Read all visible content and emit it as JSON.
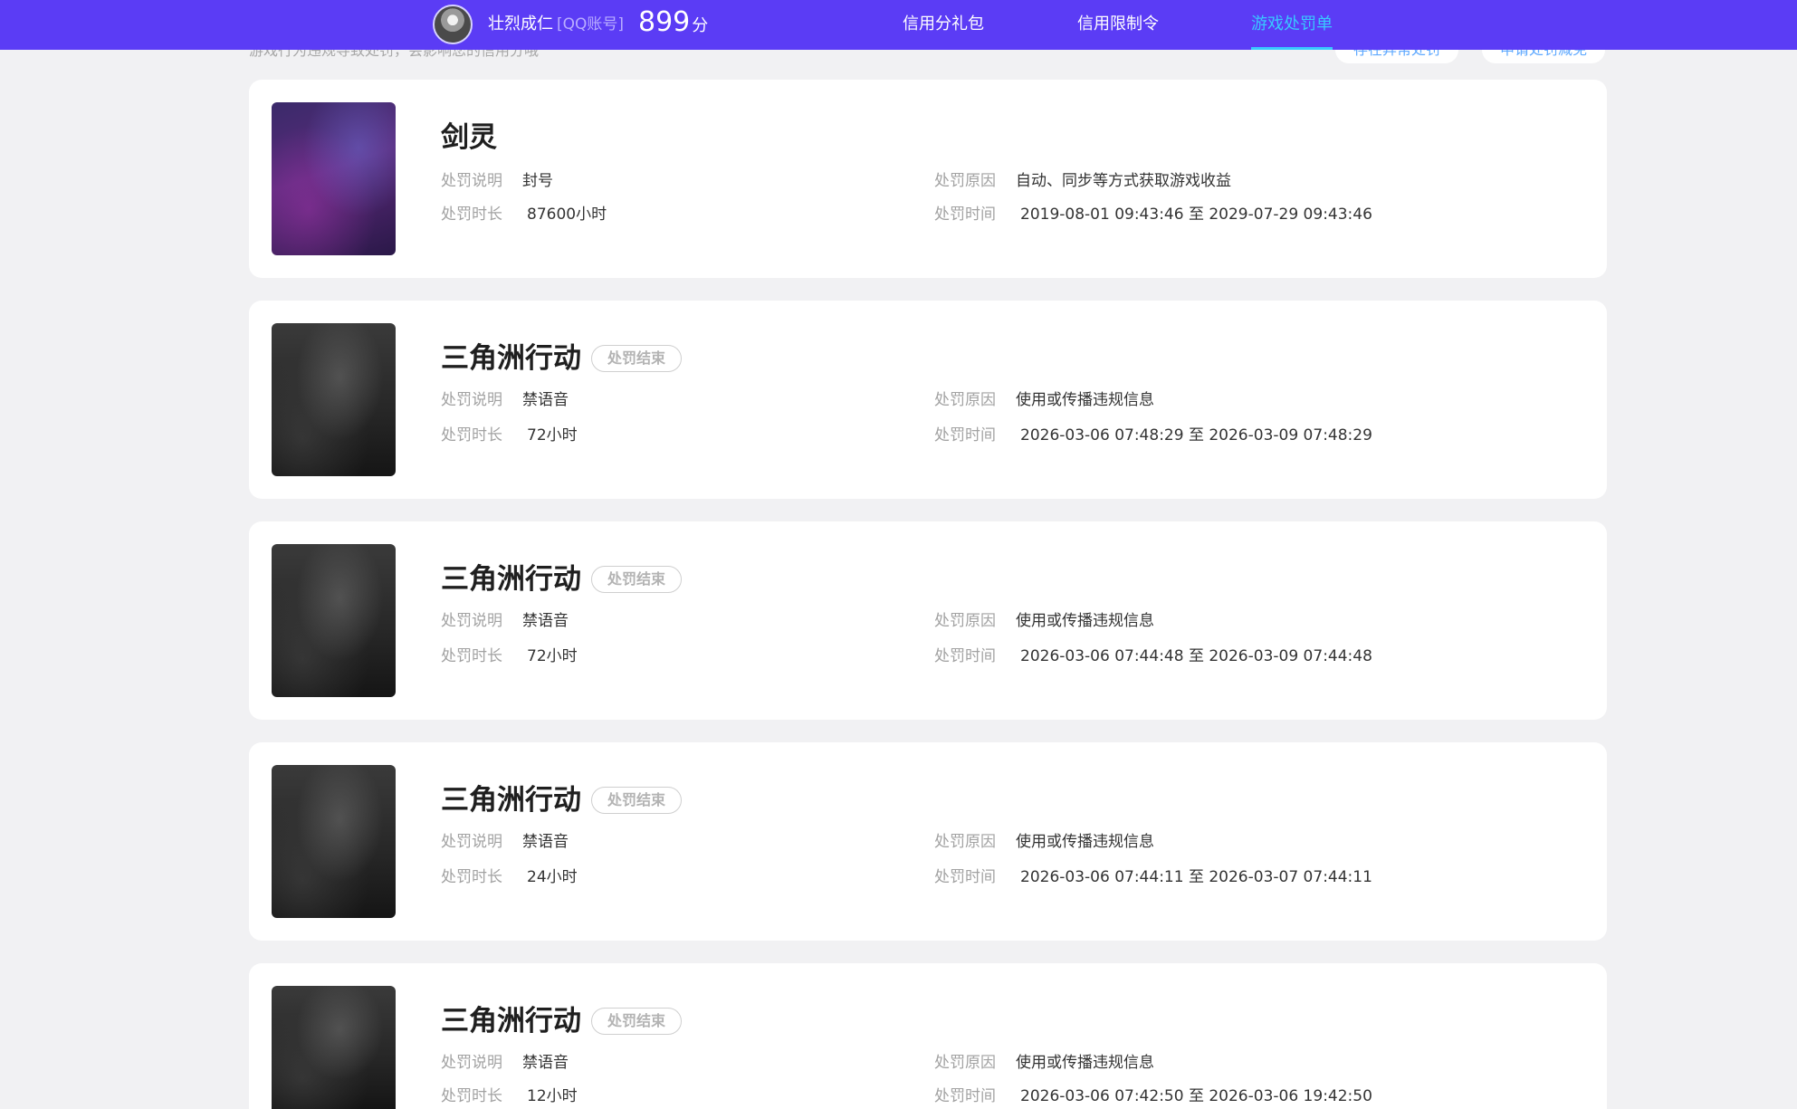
{
  "header": {
    "username": "壮烈成仁",
    "account_type": "[QQ账号]",
    "score": "899",
    "score_unit": "分",
    "tabs": [
      {
        "label": "信用分礼包"
      },
      {
        "label": "信用限制令"
      },
      {
        "label": "游戏处罚单"
      }
    ]
  },
  "peek": {
    "text": "游戏行为违规导致处罚，会影响您的信用分哦",
    "button_1": "存在异常处罚",
    "button_2": "申请处罚减免"
  },
  "labels": {
    "desc": "处罚说明",
    "duration": "处罚时长",
    "reason": "处罚原因",
    "time": "处罚时间"
  },
  "records": [
    {
      "game": "剑灵",
      "badge": "",
      "desc": "封号",
      "duration": "87600小时",
      "reason": "自动、同步等方式获取游戏收益",
      "time": "2019-08-01 09:43:46 至 2029-07-29 09:43:46"
    },
    {
      "game": "三角洲行动",
      "badge": "处罚结束",
      "desc": "禁语音",
      "duration": "72小时",
      "reason": "使用或传播违规信息",
      "time": "2026-03-06 07:48:29 至 2026-03-09 07:48:29"
    },
    {
      "game": "三角洲行动",
      "badge": "处罚结束",
      "desc": "禁语音",
      "duration": "72小时",
      "reason": "使用或传播违规信息",
      "time": "2026-03-06 07:44:48 至 2026-03-09 07:44:48"
    },
    {
      "game": "三角洲行动",
      "badge": "处罚结束",
      "desc": "禁语音",
      "duration": "24小时",
      "reason": "使用或传播违规信息",
      "time": "2026-03-06 07:44:11 至 2026-03-07 07:44:11"
    },
    {
      "game": "三角洲行动",
      "badge": "处罚结束",
      "desc": "禁语音",
      "duration": "12小时",
      "reason": "使用或传播违规信息",
      "time": "2026-03-06 07:42:50 至 2026-03-06 19:42:50"
    }
  ]
}
